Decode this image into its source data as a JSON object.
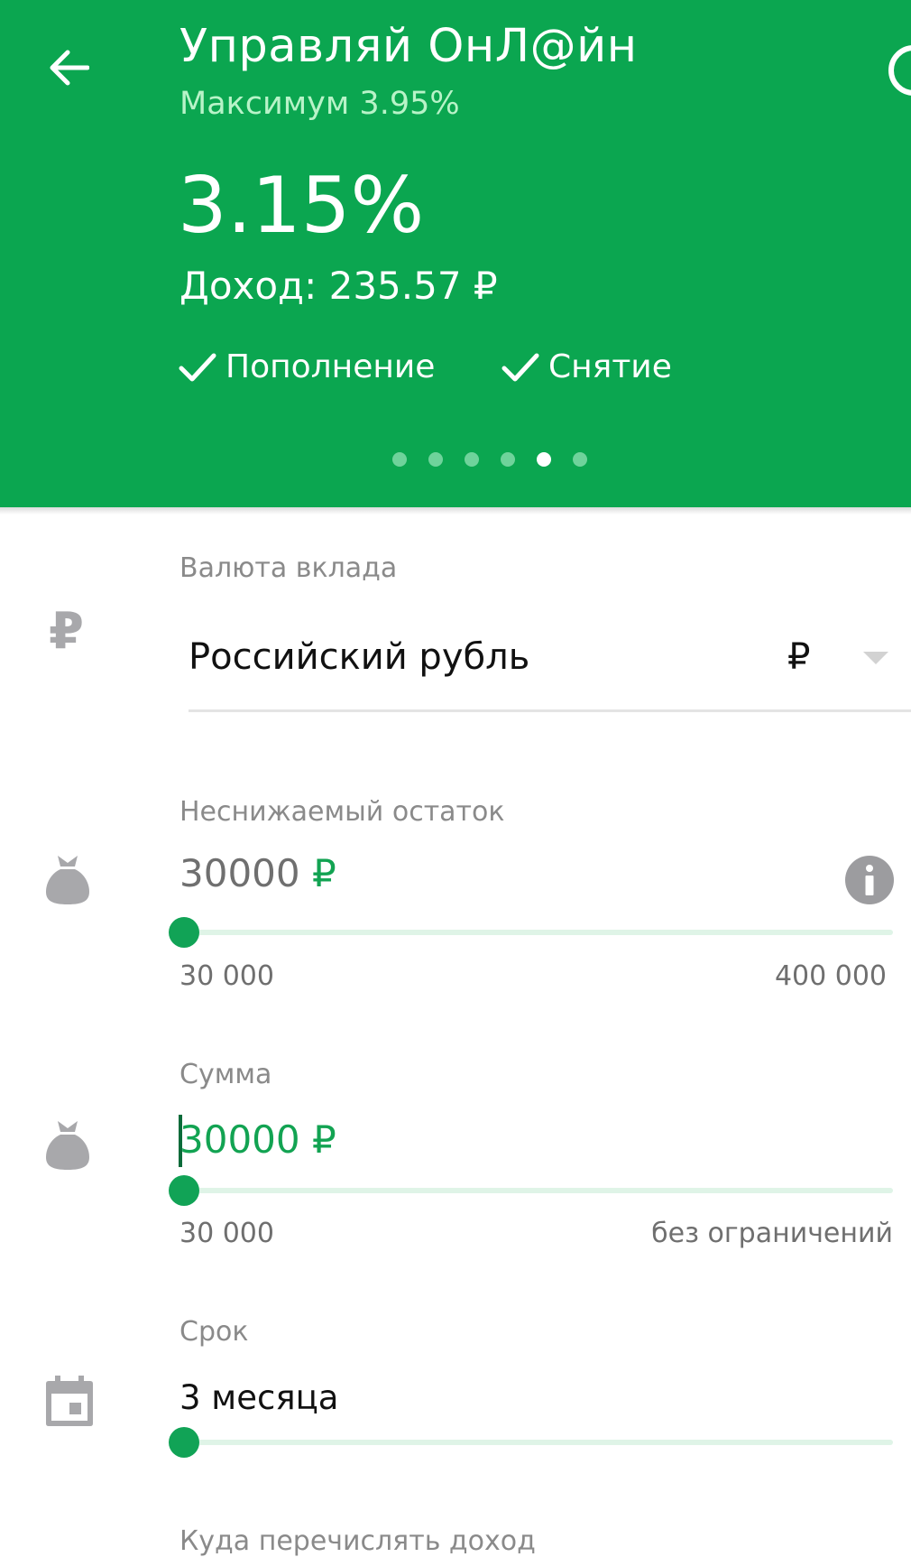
{
  "header": {
    "title": "Управляй ОнЛ@йн",
    "subtitle": "Максимум 3.95%",
    "rate": "3.15%",
    "income": "Доход: 235.57 ₽",
    "features": [
      {
        "label": "Пополнение"
      },
      {
        "label": "Снятие"
      }
    ],
    "pager": {
      "count": 6,
      "active_index": 4
    },
    "colors": {
      "background": "#0ba650",
      "subtitle": "#b8f3c8"
    }
  },
  "currency": {
    "label": "Валюта вклада",
    "selected": "Российский рубль",
    "symbol": "₽",
    "icon": "ruble-icon"
  },
  "min_balance": {
    "label": "Неснижаемый остаток",
    "value": "30000",
    "currency": "₽",
    "icon": "money-bag-icon",
    "info_icon": "info-icon",
    "min_label": "30 000",
    "max_label": "400 000",
    "slider_fraction": 0
  },
  "amount": {
    "label": "Сумма",
    "value": "30000",
    "currency": "₽",
    "icon": "money-bag-icon",
    "min_label": "30 000",
    "max_label": "без ограничений",
    "slider_fraction": 0
  },
  "term": {
    "label": "Срок",
    "value": "3 месяца",
    "icon": "calendar-icon",
    "slider_fraction": 0
  },
  "next_section": {
    "label_partial": "Куда перечислять доход"
  },
  "accent_color": "#11a356"
}
